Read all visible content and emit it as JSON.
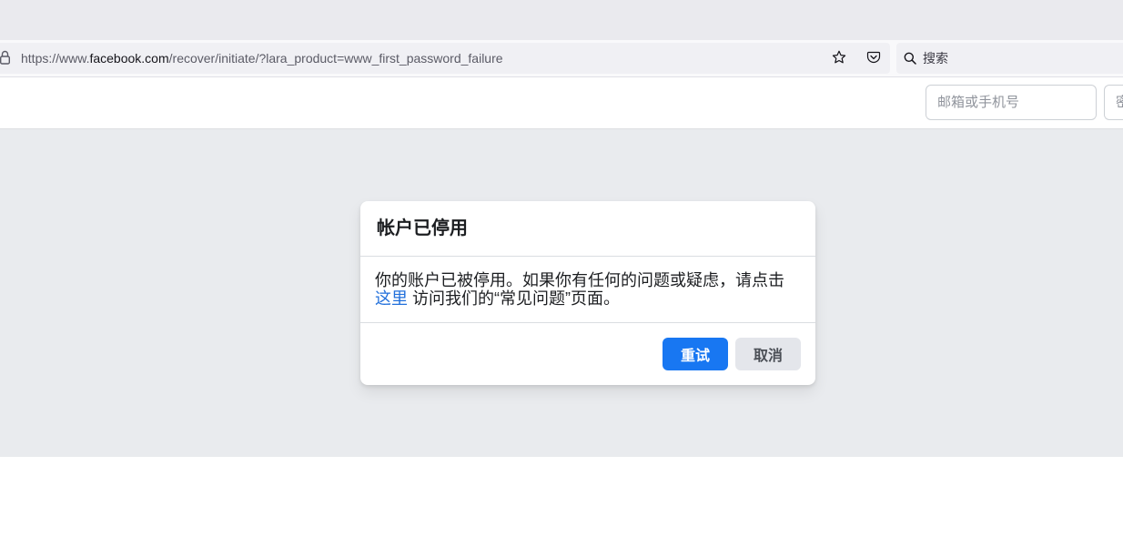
{
  "browser": {
    "url_prefix": "https://www.",
    "url_host": "facebook.com",
    "url_path": "/recover/initiate/?lara_product=www_first_password_failure",
    "search_placeholder": "搜索",
    "icons": {
      "lock": "lock-icon",
      "bookmark": "star-icon",
      "pocket": "pocket-icon",
      "search": "search-icon"
    }
  },
  "header": {
    "email_placeholder": "邮箱或手机号",
    "password_placeholder": "密"
  },
  "dialog": {
    "title": "帐户已停用",
    "message_before_link": "你的账户已被停用。如果你有任何的问题或疑虑，请点击",
    "link_text": "这里",
    "message_after_link": " 访问我们的“常见问题”页面。",
    "retry_label": "重试",
    "cancel_label": "取消"
  },
  "colors": {
    "primary_button": "#1877f2",
    "secondary_button": "#e4e6eb",
    "link": "#216fdb",
    "page_background": "#e9ebee",
    "text": "#1c1e21"
  }
}
